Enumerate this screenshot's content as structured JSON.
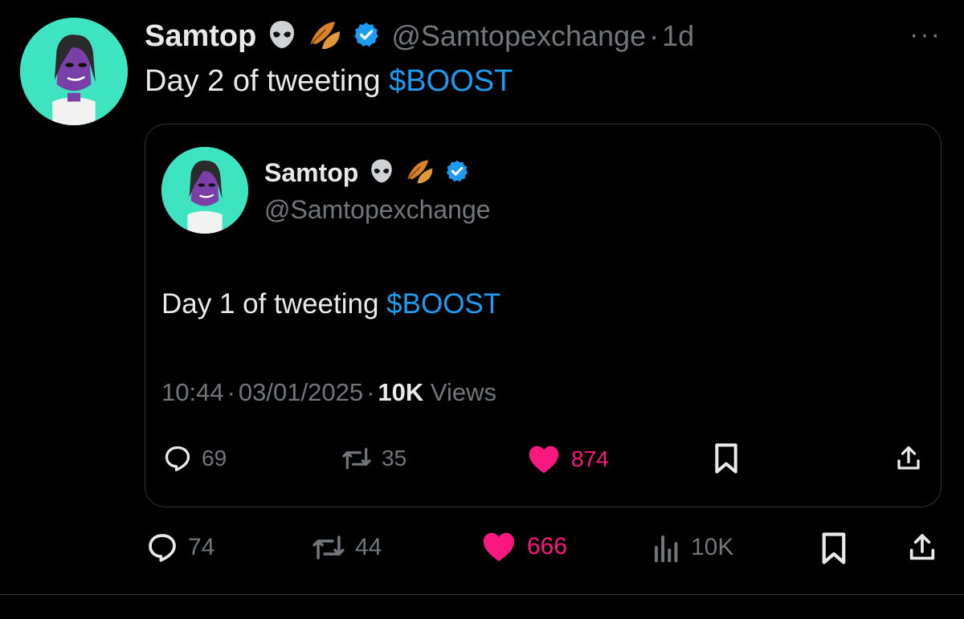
{
  "tweet": {
    "author_name": "Samtop",
    "handle": "@Samtopexchange",
    "separator": "·",
    "time_ago": "1d",
    "text_prefix": "Day 2 of tweeting ",
    "cashtag": "$BOOST",
    "emojis": [
      "alien-icon",
      "fallen-leaf-icon"
    ],
    "more_label": "···",
    "actions": {
      "replies": "74",
      "reposts": "44",
      "likes": "666",
      "views": "10K"
    }
  },
  "quote": {
    "author_name": "Samtop",
    "handle": "@Samtopexchange",
    "text_prefix": "Day 1 of tweeting ",
    "cashtag": "$BOOST",
    "time": "10:44",
    "separator": "·",
    "date": "03/01/2025",
    "views_count": "10K",
    "views_label": "Views",
    "actions": {
      "replies": "69",
      "reposts": "35",
      "likes": "874"
    }
  },
  "colors": {
    "background": "#000000",
    "text": "#e7e9ea",
    "muted": "#71767b",
    "accent": "#1d9bf0",
    "like": "#f91880",
    "avatar_bg": "#3ee3c0"
  }
}
